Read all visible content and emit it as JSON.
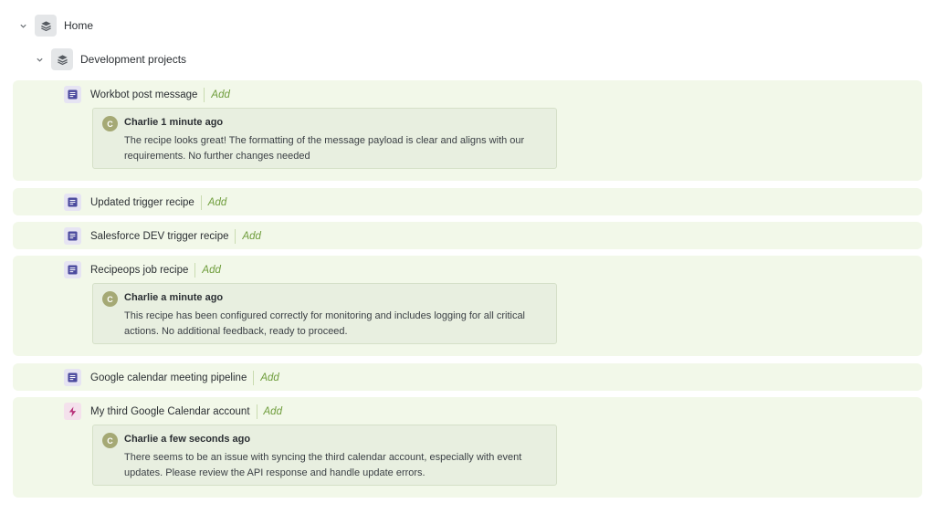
{
  "tree": {
    "home": {
      "label": "Home"
    },
    "folder": {
      "label": "Development projects"
    }
  },
  "recipes": [
    {
      "name": "Workbot post message",
      "icon": "document-icon",
      "add_label": "Add",
      "comment": {
        "avatar_initial": "C",
        "author": "Charlie",
        "time": "1 minute ago",
        "text": "The recipe looks great! The formatting of the message payload is clear and aligns with our requirements. No further changes needed"
      }
    },
    {
      "name": "Updated trigger recipe",
      "icon": "document-icon",
      "add_label": "Add"
    },
    {
      "name": "Salesforce DEV trigger recipe",
      "icon": "document-icon",
      "add_label": "Add"
    },
    {
      "name": "Recipeops job recipe",
      "icon": "document-icon",
      "add_label": "Add",
      "comment": {
        "avatar_initial": "C",
        "author": "Charlie",
        "time": "a minute ago",
        "text": "This recipe has been configured correctly for monitoring and includes logging for all critical actions. No additional feedback, ready to proceed."
      }
    },
    {
      "name": "Google calendar meeting pipeline",
      "icon": "document-icon",
      "add_label": "Add"
    },
    {
      "name": "My third Google Calendar account",
      "icon": "lightning-icon",
      "add_label": "Add",
      "comment": {
        "avatar_initial": "C",
        "author": "Charlie",
        "time": "a few seconds ago",
        "text": "There seems to be an issue with syncing the third calendar account, especially with event updates. Please review the API response and handle update errors."
      }
    }
  ],
  "colors": {
    "row_background": "#f2f8e9",
    "comment_background": "#e8efe0",
    "add_link": "#6f9d3c",
    "document_icon": "#4b4a9e",
    "lightning_icon": "#b8327a",
    "avatar": "#a5a975"
  }
}
